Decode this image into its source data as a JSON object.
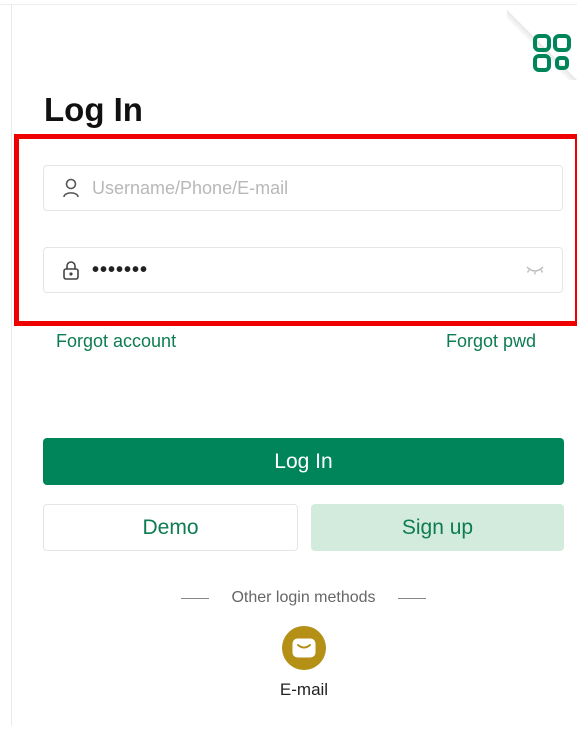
{
  "page": {
    "title": "Log In"
  },
  "icons": {
    "qr": "qr-code-icon",
    "user": "user-icon",
    "lock": "lock-icon",
    "eye": "eye-closed-icon",
    "email": "email-icon"
  },
  "form": {
    "username": {
      "placeholder": "Username/Phone/E-mail",
      "value": ""
    },
    "password": {
      "value": "1234567"
    }
  },
  "links": {
    "forgot_account": "Forgot account",
    "forgot_pwd": "Forgot pwd"
  },
  "buttons": {
    "login": "Log In",
    "demo": "Demo",
    "signup": "Sign up"
  },
  "other_methods": {
    "label": "Other login methods",
    "methods": [
      {
        "label": "E-mail",
        "icon": "email-icon"
      }
    ]
  },
  "colors": {
    "brand_green": "#00855a",
    "link_green": "#0d7c52",
    "signup_bg": "#d3ebdc",
    "email_icon_bg": "#b59016",
    "highlight_red": "#ee0000"
  }
}
